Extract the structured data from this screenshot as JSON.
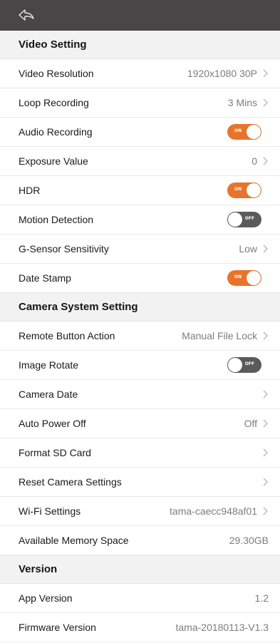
{
  "colors": {
    "topbar": "#4a4547",
    "accent": "#e8742b",
    "toggle_off": "#5b5b5b",
    "section_bg": "#f2f2f2"
  },
  "topbar": {
    "back_icon": "back-arrow-icon"
  },
  "sections": {
    "video": {
      "title": "Video Setting",
      "video_resolution": {
        "label": "Video Resolution",
        "value": "1920x1080 30P"
      },
      "loop_recording": {
        "label": "Loop Recording",
        "value": "3 Mins"
      },
      "audio_recording": {
        "label": "Audio Recording",
        "state": "ON"
      },
      "exposure_value": {
        "label": "Exposure Value",
        "value": "0"
      },
      "hdr": {
        "label": "HDR",
        "state": "ON"
      },
      "motion_detection": {
        "label": "Motion Detection",
        "state": "OFF"
      },
      "g_sensor": {
        "label": "G-Sensor Sensitivity",
        "value": "Low"
      },
      "date_stamp": {
        "label": "Date Stamp",
        "state": "ON"
      }
    },
    "camera": {
      "title": "Camera System Setting",
      "remote_button": {
        "label": "Remote Button Action",
        "value": "Manual File Lock"
      },
      "image_rotate": {
        "label": "Image Rotate",
        "state": "OFF"
      },
      "camera_date": {
        "label": "Camera Date"
      },
      "auto_power_off": {
        "label": "Auto Power Off",
        "value": "Off"
      },
      "format_sd": {
        "label": "Format SD Card"
      },
      "reset_settings": {
        "label": "Reset Camera Settings"
      },
      "wifi_settings": {
        "label": "Wi-Fi Settings",
        "value": "tama-caecc948af01"
      },
      "memory": {
        "label": "Available Memory Space",
        "value": "29.30GB"
      }
    },
    "version": {
      "title": "Version",
      "app_version": {
        "label": "App Version",
        "value": "1.2"
      },
      "firmware_version": {
        "label": "Firmware Version",
        "value": "tama-20180113-V1.3"
      }
    }
  }
}
